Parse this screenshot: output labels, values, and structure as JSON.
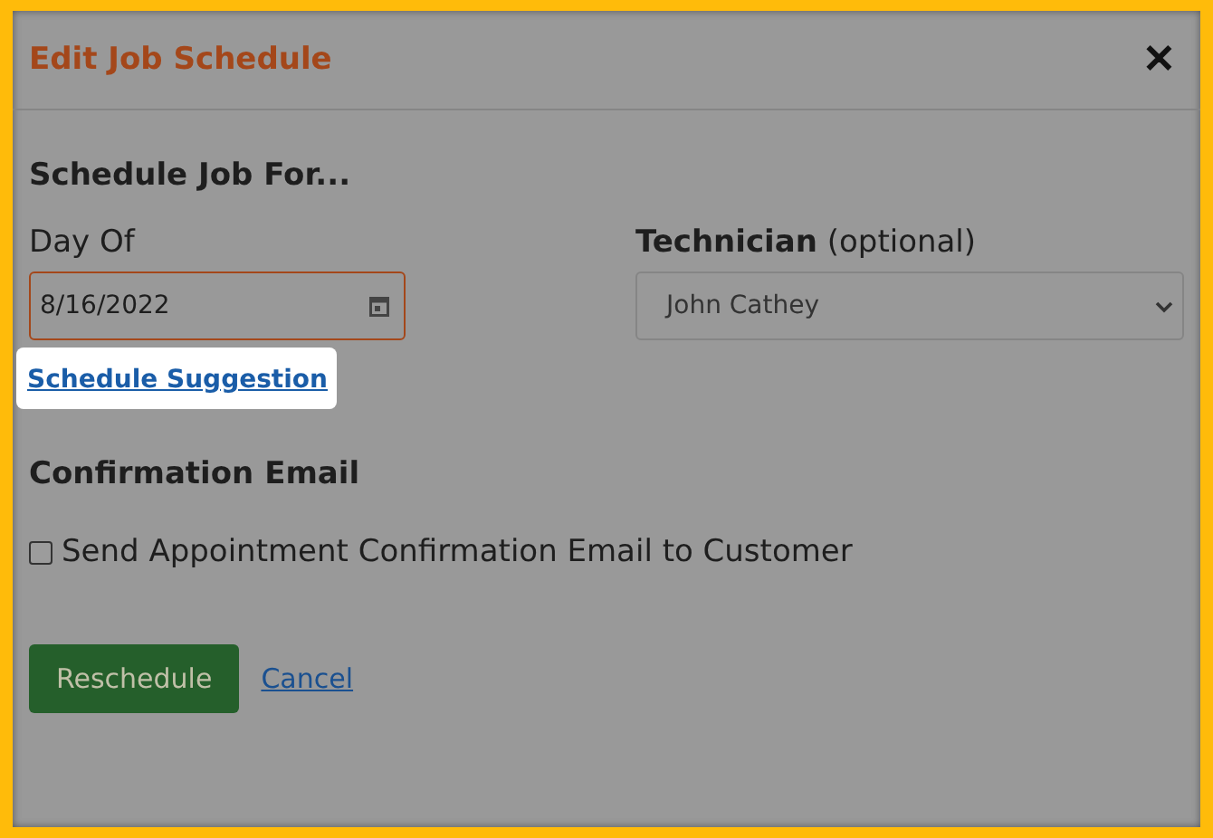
{
  "dialog": {
    "title": "Edit Job Schedule",
    "close": "✕"
  },
  "section_heading": "Schedule Job For...",
  "day_field": {
    "label": "Day Of",
    "value": "8/16/2022"
  },
  "technician_field": {
    "label": "**Technician** (optional)",
    "value": "John Cathey"
  },
  "suggestion_link": "Schedule Suggestion",
  "email_heading": "Confirmation Email",
  "email_option": {
    "label": "Send Appointment Confirmation Email to Customer",
    "checked": false
  },
  "buttons": [
    {
      "kind": "primary",
      "label": "Reschedule"
    },
    {
      "kind": "link",
      "label": "Cancel"
    }
  ]
}
